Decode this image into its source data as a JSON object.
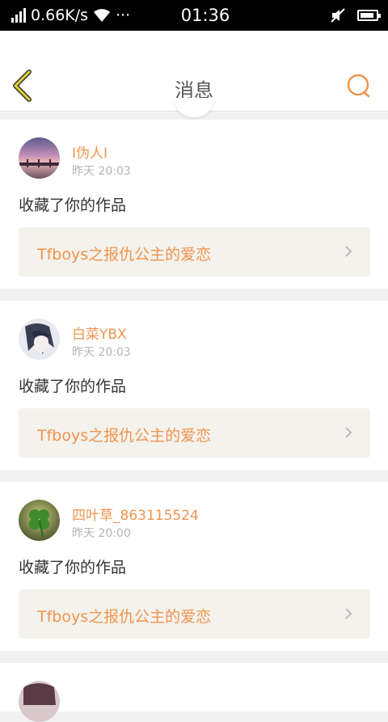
{
  "status_bar": {
    "network_speed": "0.66K/s",
    "more": "···",
    "time": "01:36"
  },
  "header": {
    "title": "消息",
    "back_icon": "chevron-left-icon",
    "search_icon": "search-icon"
  },
  "colors": {
    "accent": "#f0944e",
    "back_icon": "#d8c23c",
    "link_bg": "#f4f2ec"
  },
  "messages": [
    {
      "username": "I伪人I",
      "time": "昨天 20:03",
      "action": "收藏了你的作品",
      "work_title": "Tfboys之报仇公主的爱恋"
    },
    {
      "username": "白菜YBX",
      "time": "昨天 20:03",
      "action": "收藏了你的作品",
      "work_title": "Tfboys之报仇公主的爱恋"
    },
    {
      "username": "四叶草_863115524",
      "time": "昨天 20:00",
      "action": "收藏了你的作品",
      "work_title": "Tfboys之报仇公主的爱恋"
    }
  ]
}
